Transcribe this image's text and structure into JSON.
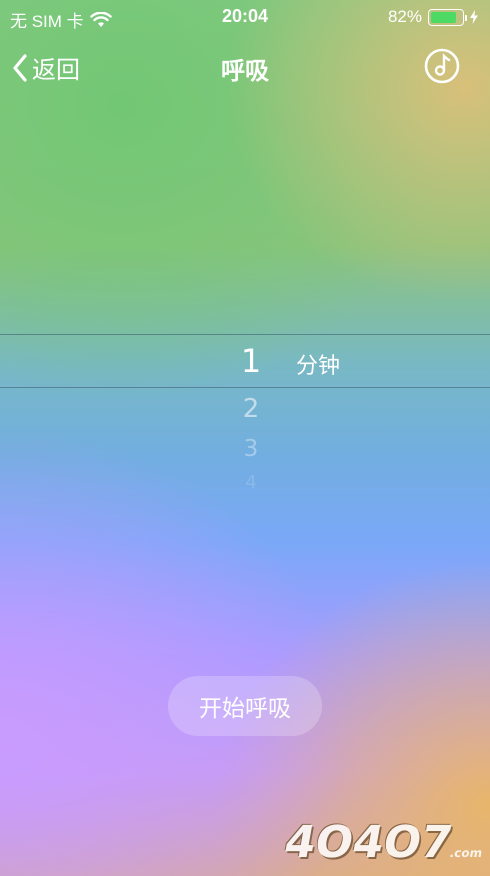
{
  "status_bar": {
    "carrier": "无 SIM 卡",
    "time": "20:04",
    "battery_percent": "82%",
    "battery_level": 0.82,
    "icons": [
      "wifi-icon",
      "battery-icon",
      "charging-bolt-icon"
    ]
  },
  "nav": {
    "back_label": "返回",
    "title": "呼吸",
    "right_icon": "music-note-icon"
  },
  "picker": {
    "selected": "1",
    "unit": "分钟",
    "options": [
      "1",
      "2",
      "3",
      "4"
    ]
  },
  "start_button": {
    "label": "开始呼吸"
  },
  "watermark": {
    "text": "4O4O7",
    "suffix": ".com"
  },
  "colors": {
    "battery_green": "#4cd964",
    "accent": "#ffffff"
  }
}
